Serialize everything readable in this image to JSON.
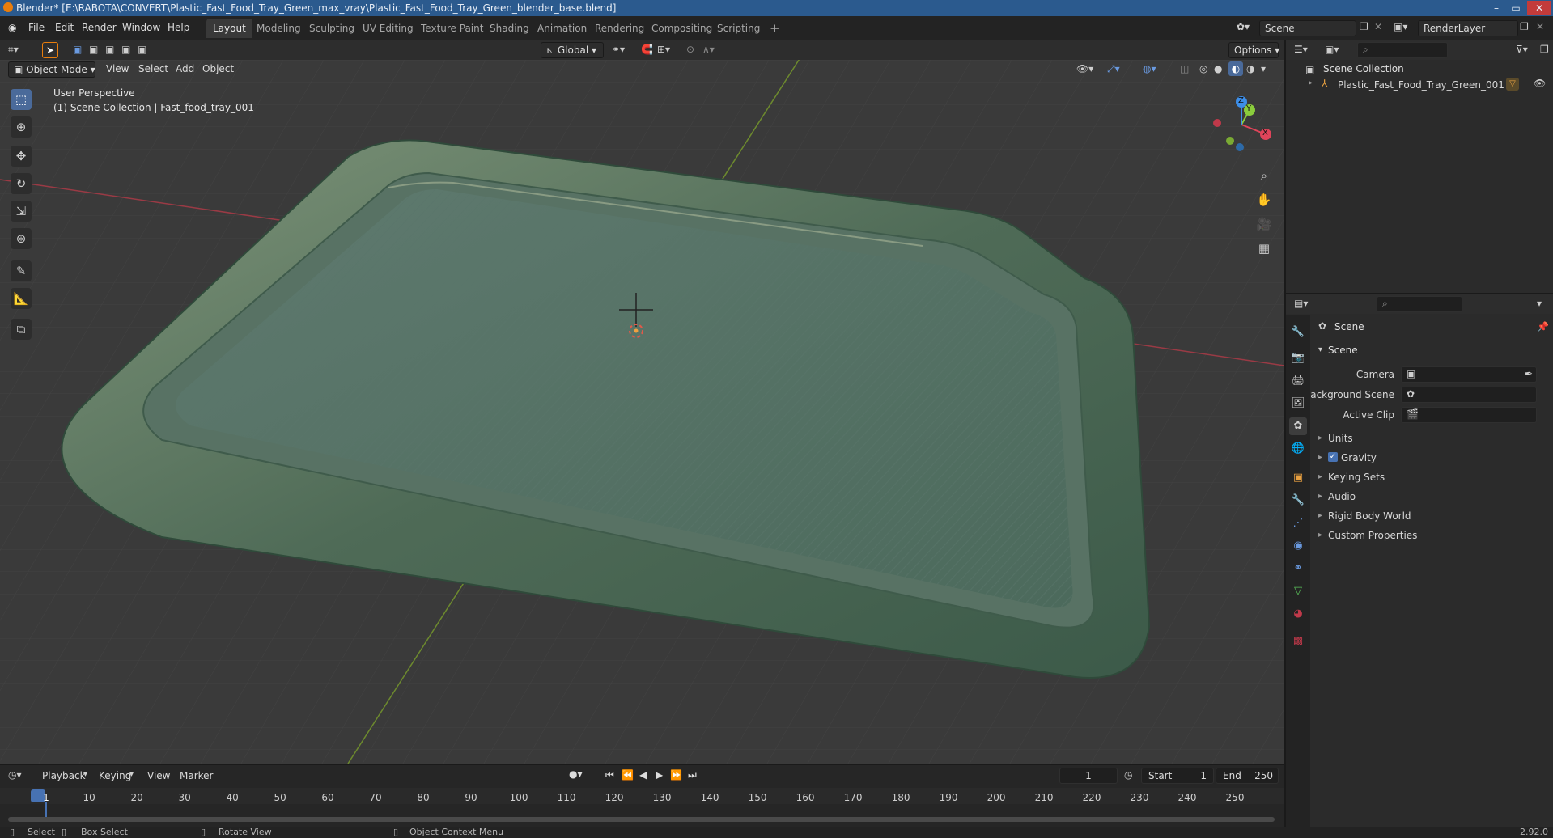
{
  "window": {
    "title": "Blender* [E:\\RABOTA\\CONVERT\\Plastic_Fast_Food_Tray_Green_max_vray\\Plastic_Fast_Food_Tray_Green_blender_base.blend]",
    "minimize": "–",
    "maximize": "▭",
    "close": "✕"
  },
  "menu": [
    "File",
    "Edit",
    "Render",
    "Window",
    "Help"
  ],
  "workspaces": [
    "Layout",
    "Modeling",
    "Sculpting",
    "UV Editing",
    "Texture Paint",
    "Shading",
    "Animation",
    "Rendering",
    "Compositing",
    "Scripting",
    "+"
  ],
  "scene_selector": {
    "value": "Scene"
  },
  "renderlayer_selector": {
    "value": "RenderLayer"
  },
  "viewport_header": {
    "transform_orientation": "Global",
    "options": "Options",
    "mode": "Object Mode",
    "menus": [
      "View",
      "Select",
      "Add",
      "Object"
    ]
  },
  "viewport_overlay": {
    "perspective": "User Perspective",
    "collection": "(1) Scene Collection | Fast_food_tray_001"
  },
  "gizmo": {
    "x": "X",
    "y": "Y",
    "z": "Z"
  },
  "outliner": {
    "root": "Scene Collection",
    "items": [
      {
        "label": "Plastic_Fast_Food_Tray_Green_001"
      }
    ]
  },
  "properties": {
    "context": "Scene",
    "section": "Scene",
    "fields": [
      {
        "label": "Camera",
        "value": ""
      },
      {
        "label": "Background Scene",
        "value": ""
      },
      {
        "label": "Active Clip",
        "value": ""
      }
    ],
    "panels": [
      "Units",
      "Gravity",
      "Keying Sets",
      "Audio",
      "Rigid Body World",
      "Custom Properties"
    ],
    "gravity_checked": true
  },
  "timeline": {
    "menus": [
      "Playback",
      "Keying",
      "View",
      "Marker"
    ],
    "current_frame": "1",
    "start_label": "Start",
    "start": "1",
    "end_label": "End",
    "end": "250",
    "ticks": [
      "1",
      "10",
      "20",
      "30",
      "40",
      "50",
      "60",
      "70",
      "80",
      "90",
      "100",
      "110",
      "120",
      "130",
      "140",
      "150",
      "160",
      "170",
      "180",
      "190",
      "200",
      "210",
      "220",
      "230",
      "240",
      "250"
    ]
  },
  "statusbar": {
    "select": "Select",
    "box_select": "Box Select",
    "rotate_view": "Rotate View",
    "context_menu": "Object Context Menu",
    "version": "2.92.0"
  },
  "colors": {
    "accent": "#4772b3",
    "x_axis": "#e0445a",
    "y_axis": "#8acc3c",
    "z_axis": "#3d8ee8",
    "tray": "#4f6a5a"
  }
}
